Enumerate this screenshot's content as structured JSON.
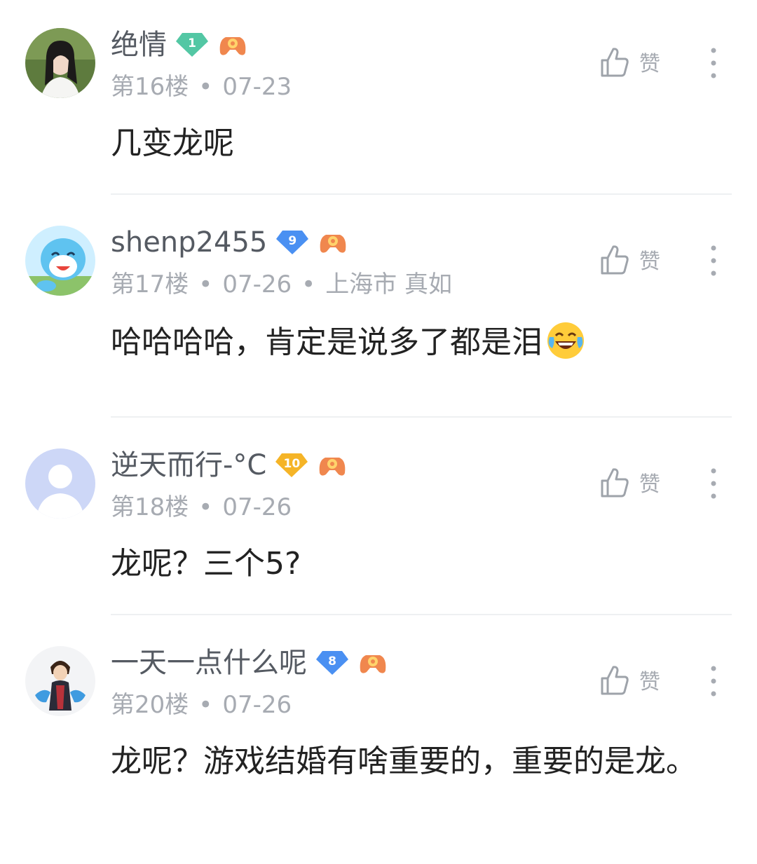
{
  "like_label": "赞",
  "comments": [
    {
      "username": "绝情",
      "level": "1",
      "level_color": "#53c7a4",
      "floor": "第16楼",
      "date": "07-23",
      "location": "",
      "text": "几变龙呢",
      "avatar": "avatar-photo-woman-icon"
    },
    {
      "username": "shenp2455",
      "level": "9",
      "level_color": "#4a90f2",
      "floor": "第17楼",
      "date": "07-26",
      "location": "上海市 真如",
      "text": "哈哈哈哈，肯定是说多了都是泪",
      "emoji": "laughing-crying-emoji-icon",
      "avatar": "avatar-cartoon-blue-creature-icon"
    },
    {
      "username": "逆天而行-°C",
      "level": "10",
      "level_color": "#f5b427",
      "floor": "第18楼",
      "date": "07-26",
      "location": "",
      "text": "龙呢？三个5?",
      "avatar": "avatar-default-silhouette-icon"
    },
    {
      "username": "一天一点什么呢",
      "level": "8",
      "level_color": "#4a90f2",
      "floor": "第20楼",
      "date": "07-26",
      "location": "",
      "text": "龙呢？游戏结婚有啥重要的，重要的是龙。",
      "avatar": "avatar-anime-swordsman-icon"
    }
  ]
}
